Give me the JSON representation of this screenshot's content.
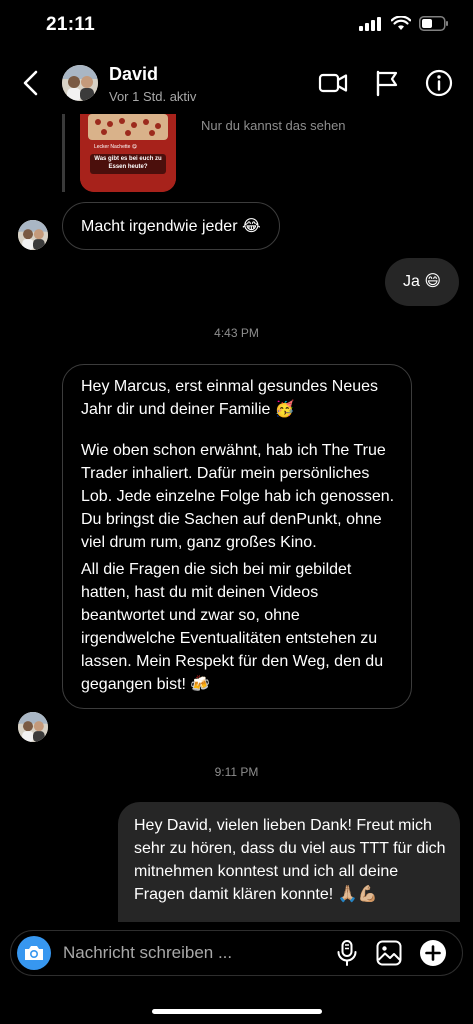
{
  "status_bar": {
    "time": "21:11"
  },
  "header": {
    "contact_name": "David",
    "contact_status": "Vor 1 Std. aktiv",
    "icons": [
      "back-arrow-icon",
      "video-call-icon",
      "flag-icon",
      "info-icon"
    ]
  },
  "story_reply": {
    "caption": "Nur du kannst das sehen",
    "thumb_title": "Lecker Nachette 😋",
    "thumb_question": "Was gibt es bei euch zu Essen heute?"
  },
  "messages": [
    {
      "direction": "in",
      "text": "Macht irgendwie jeder 😂"
    },
    {
      "direction": "out",
      "text": "Ja 😄"
    },
    {
      "direction": "in",
      "paragraphs": [
        "Hey Marcus, erst einmal gesundes Neues Jahr dir und deiner Familie 🥳",
        "Wie oben schon erwähnt, hab ich The True Trader inhaliert. Dafür mein persönliches Lob. Jede einzelne Folge hab ich genossen. Du bringst die Sachen auf denPunkt, ohne viel drum rum, ganz großes Kino.",
        "All die Fragen die sich bei mir gebildet hatten, hast du mit deinen Videos beantwortet und zwar so, ohne irgendwelche Eventualitäten entstehen zu lassen. Mein Respekt für den Weg, den du gegangen bist! 🍻"
      ]
    },
    {
      "direction": "out",
      "text": "Hey David, vielen lieben Dank! Freut mich sehr zu hören, dass du viel aus TTT für dich mitnehmen konntest und ich all deine Fragen damit klären konnte! 🙏🏼💪🏼"
    }
  ],
  "timestamps": {
    "first": "4:43 PM",
    "second": "9:11 PM"
  },
  "composer": {
    "placeholder": "Nachricht schreiben ...",
    "icons": [
      "camera-icon",
      "microphone-icon",
      "gallery-icon",
      "plus-icon"
    ]
  },
  "colors": {
    "background": "#000000",
    "outgoing_bubble": "#262626",
    "incoming_border": "#3c3c3c",
    "accent_blue": "#3797f0",
    "secondary_text": "#a8a8a8"
  }
}
